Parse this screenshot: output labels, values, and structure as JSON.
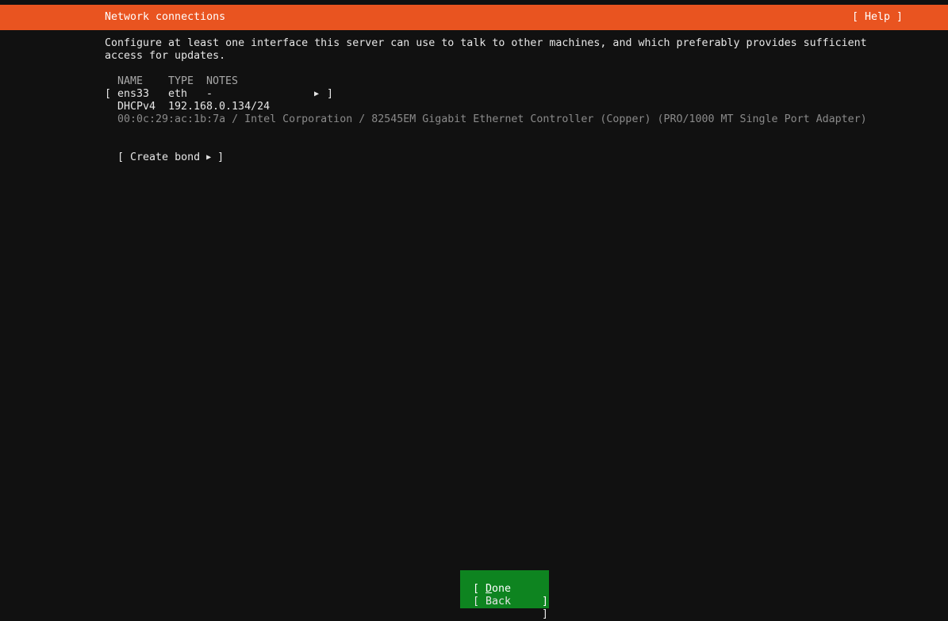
{
  "header": {
    "title": "Network connections",
    "help_label": "[ Help ]"
  },
  "description": {
    "line1": "Configure at least one interface this server can use to talk to other machines, and which preferably provides sufficient",
    "line2": "access for updates."
  },
  "table": {
    "columns": {
      "name": "NAME",
      "type": "TYPE",
      "notes": "NOTES"
    },
    "interfaces": [
      {
        "open_bracket": "[",
        "name": "ens33",
        "type": "eth",
        "notes": "-",
        "arrow_icon": "right-triangle-icon",
        "close_bracket": "]",
        "address_method": "DHCPv4",
        "address": "192.168.0.134/24",
        "hardware": "00:0c:29:ac:1b:7a / Intel Corporation / 82545EM Gigabit Ethernet Controller (Copper) (PRO/1000 MT Single Port Adapter)"
      }
    ]
  },
  "create_bond": {
    "open": "[ Create bond",
    "arrow_icon": "right-triangle-icon",
    "close": "]"
  },
  "buttons": {
    "done_prefix": "[ ",
    "done_hotkey": "D",
    "done_rest": "one",
    "done_suffix": "]",
    "back_label": "[ Back",
    "back_suffix": "]"
  },
  "colors": {
    "header_bg": "#e95420",
    "background": "#111111",
    "done_bg": "#0e8420"
  }
}
